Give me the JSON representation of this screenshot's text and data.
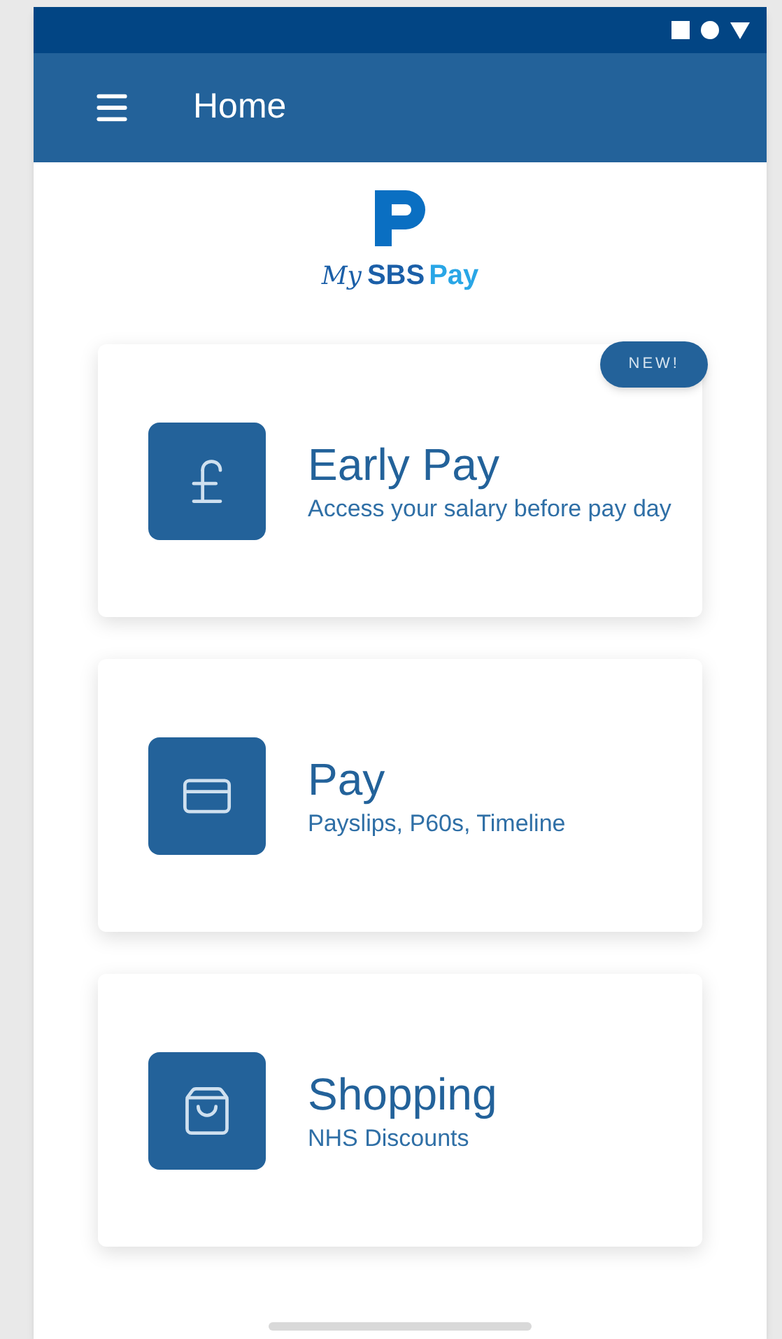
{
  "app_bar": {
    "title": "Home"
  },
  "logo": {
    "prefix": "My",
    "brand": "SBS",
    "suffix": "Pay"
  },
  "cards": [
    {
      "kind": "pound",
      "title": "Early Pay",
      "subtitle": "Access your salary before pay day",
      "badge": "NEW!"
    },
    {
      "kind": "card",
      "title": "Pay",
      "subtitle": "Payslips, P60s, Timeline"
    },
    {
      "kind": "bag",
      "title": "Shopping",
      "subtitle": "NHS Discounts"
    }
  ]
}
